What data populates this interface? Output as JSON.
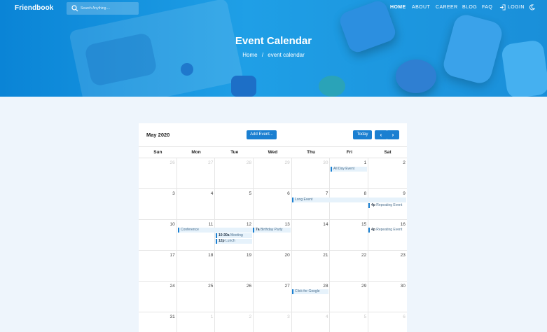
{
  "header": {
    "logo": "Friendbook",
    "search_placeholder": "Search Anything....",
    "nav": [
      "HOME",
      "ABOUT",
      "CAREER",
      "BLOG",
      "FAQ"
    ],
    "login": "LOGIN",
    "icons": [
      "search-icon",
      "login-icon",
      "moon-icon"
    ]
  },
  "hero": {
    "title": "Event Calendar",
    "breadcrumb": [
      "Home",
      "/",
      "event calendar"
    ]
  },
  "calendar": {
    "month": "May 2020",
    "add_event": "Add Event...",
    "today": "Today",
    "prev": "‹",
    "next": "›",
    "days_of_week": [
      "Sun",
      "Mon",
      "Tue",
      "Wed",
      "Thu",
      "Fri",
      "Sat"
    ],
    "weeks": [
      [
        "26",
        "27",
        "28",
        "29",
        "30",
        "1",
        "2"
      ],
      [
        "3",
        "4",
        "5",
        "6",
        "7",
        "8",
        "9"
      ],
      [
        "10",
        "11",
        "12",
        "13",
        "14",
        "15",
        "16"
      ],
      [
        "17",
        "18",
        "19",
        "20",
        "21",
        "22",
        "23"
      ],
      [
        "24",
        "25",
        "26",
        "27",
        "28",
        "29",
        "30"
      ],
      [
        "31",
        "1",
        "2",
        "3",
        "4",
        "5",
        "6"
      ]
    ],
    "events": {
      "all_day": "All Day Event",
      "long_event": "Long Event",
      "repeat_1_time": "4p",
      "repeat_1_title": "Repeating Event",
      "conference": "Conference",
      "meeting_time": "10:30a",
      "meeting_title": "Meeting",
      "lunch_time": "12p",
      "lunch_title": "Lunch",
      "birthday_time": "7a",
      "birthday_title": "Birthday Party",
      "repeat_2_time": "4p",
      "repeat_2_title": "Repeating Event",
      "google": "Click for Google"
    }
  },
  "colors": {
    "accent": "#1a7fd1",
    "hero": "#1f9fe6",
    "background": "#eef5fc"
  }
}
